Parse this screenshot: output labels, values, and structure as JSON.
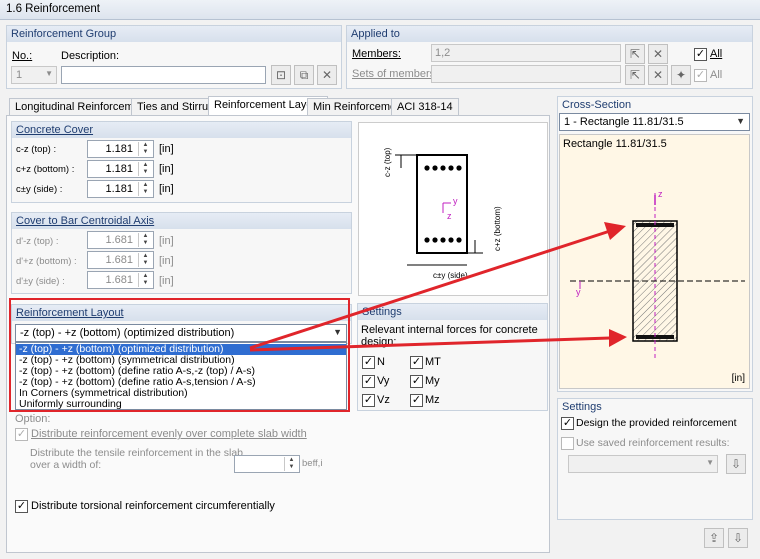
{
  "window": {
    "title": "1.6 Reinforcement"
  },
  "reinforcement_group": {
    "heading": "Reinforcement Group",
    "no_label": "No.:",
    "no_value": "1",
    "description_label": "Description:",
    "description_value": ""
  },
  "applied_to": {
    "heading": "Applied to",
    "members_label": "Members:",
    "members_value": "1,2",
    "sets_label": "Sets of members:",
    "sets_value": "",
    "all_label": "All"
  },
  "tabs": [
    {
      "label": "Longitudinal Reinforcement"
    },
    {
      "label": "Ties and Stirrups"
    },
    {
      "label": "Reinforcement Layout"
    },
    {
      "label": "Min Reinforcement"
    },
    {
      "label": "ACI 318-14"
    }
  ],
  "concrete_cover": {
    "heading": "Concrete Cover",
    "rows": [
      {
        "label": "c-z (top) :",
        "value": "1.181",
        "unit": "[in]"
      },
      {
        "label": "c+z (bottom) :",
        "value": "1.181",
        "unit": "[in]"
      },
      {
        "label": "c±y (side) :",
        "value": "1.181",
        "unit": "[in]"
      }
    ]
  },
  "cover_centroid": {
    "heading": "Cover to Bar Centroidal Axis",
    "rows": [
      {
        "label": "d'-z (top) :",
        "value": "1.681",
        "unit": "[in]"
      },
      {
        "label": "d'+z (bottom) :",
        "value": "1.681",
        "unit": "[in]"
      },
      {
        "label": "d'±y (side) :",
        "value": "1.681",
        "unit": "[in]"
      }
    ]
  },
  "reinforcement_layout": {
    "heading": "Reinforcement Layout",
    "selected": "-z (top) - +z (bottom) (optimized distribution)",
    "options": [
      "-z (top) - +z (bottom) (optimized distribution)",
      "-z (top) - +z (bottom) (symmetrical distribution)",
      "-z (top) - +z (bottom) (define ratio A-s,-z (top) / A-s)",
      "-z (top) - +z (bottom) (define ratio A-s,tension / A-s)",
      "In Corners (symmetrical distribution)",
      "Uniformly surrounding"
    ]
  },
  "options": {
    "option_label": "Option:",
    "distribute_slab": "Distribute reinforcement evenly over complete slab width",
    "tensile_text_1": "Distribute the tensile reinforcement in the slab",
    "tensile_text_2": "over a width of:",
    "beff_label": "beff,i",
    "torsional": "Distribute torsional reinforcement circumferentially"
  },
  "diagram": {
    "cz_top": "c-z (top)",
    "cz_bottom": "c+z (bottom)",
    "cy_side": "c±y (side)",
    "axis_y": "y",
    "axis_z": "z"
  },
  "settings_forces": {
    "heading": "Settings",
    "text": "Relevant internal forces for concrete design:",
    "items": [
      "N",
      "MT",
      "Vy",
      "My",
      "Vz",
      "Mz"
    ]
  },
  "cross_section": {
    "heading": "Cross-Section",
    "combo_value": "1 - Rectangle 11.81/31.5",
    "caption": "Rectangle 11.81/31.5",
    "unit": "[in]",
    "axis_y": "y",
    "axis_z": "z"
  },
  "settings_right": {
    "heading": "Settings",
    "design_provided": "Design the provided reinforcement",
    "use_saved": "Use saved reinforcement results:"
  },
  "colors": {
    "accent": "#2f6dd1",
    "highlight": "#e0252b",
    "axis": "#c020c0"
  }
}
